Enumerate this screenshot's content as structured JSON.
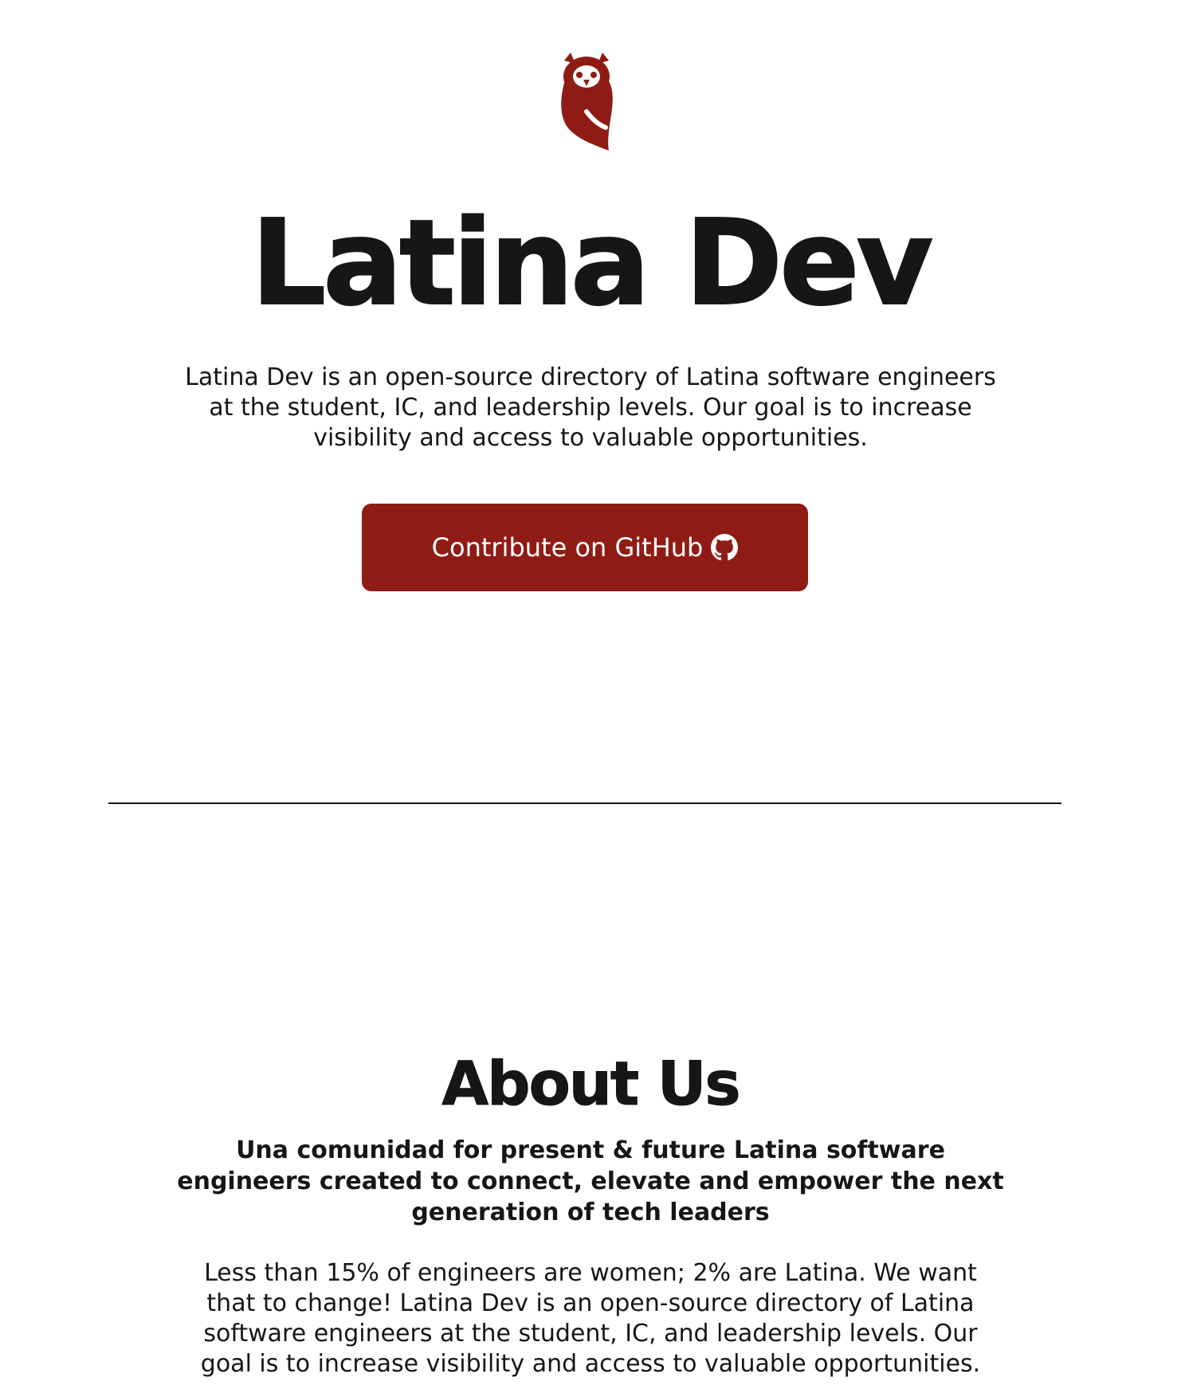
{
  "brand": {
    "logo_icon": "owl-logo-icon",
    "accent_color": "#8f1c14"
  },
  "hero": {
    "title": "Latina Dev",
    "description": "Latina Dev is an open-source directory of Latina software engineers at the student, IC, and leadership levels. Our goal is to increase visibility and access to valuable opportunities.",
    "cta": {
      "label": "Contribute on GitHub",
      "icon": "github-icon"
    }
  },
  "about": {
    "title": "About Us",
    "subtitle": "Una comunidad for present & future Latina software engineers created to connect, elevate and empower the next generation of tech leaders",
    "body": "Less than 15% of engineers are women; 2% are Latina. We want that to change! Latina Dev is an open-source directory of Latina software engineers at the student, IC, and leadership levels. Our goal is to increase visibility and access to valuable opportunities."
  }
}
